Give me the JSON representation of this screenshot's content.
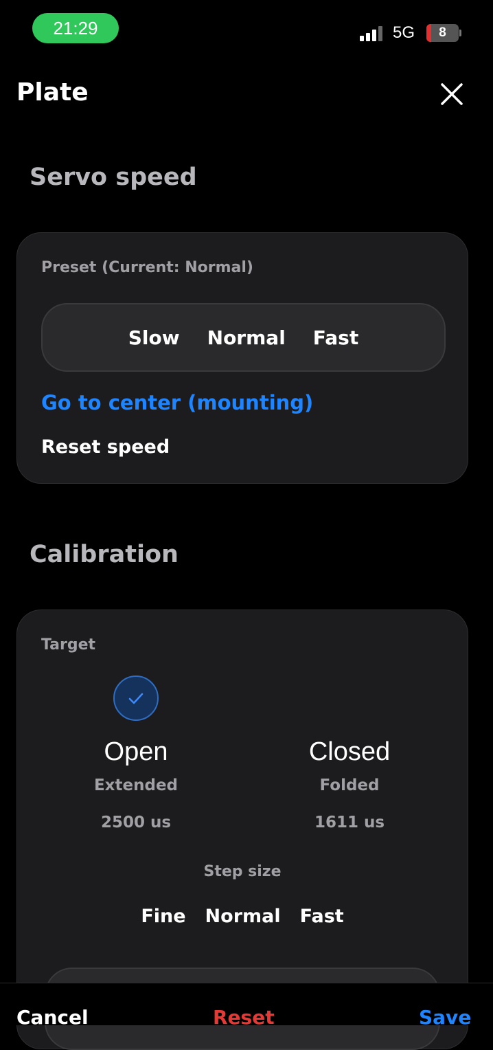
{
  "status": {
    "time": "21:29",
    "network": "5G",
    "battery": "8"
  },
  "header": {
    "title": "Plate"
  },
  "servo": {
    "title": "Servo speed",
    "preset_label": "Preset (Current: Normal)",
    "options": [
      "Slow",
      "Normal",
      "Fast"
    ],
    "center_link": "Go to center (mounting)",
    "reset_link": "Reset speed"
  },
  "calibration": {
    "title": "Calibration",
    "target_label": "Target",
    "open": {
      "name": "Open",
      "sub": "Extended",
      "value": "2500 us"
    },
    "closed": {
      "name": "Closed",
      "sub": "Folded",
      "value": "1611 us"
    },
    "step_label": "Step size",
    "step_options": [
      "Fine",
      "Normal",
      "Fast"
    ]
  },
  "footer": {
    "cancel": "Cancel",
    "reset": "Reset",
    "save": "Save"
  },
  "colors": {
    "accent": "#1e85ff",
    "danger": "#e53935",
    "success": "#30c85a"
  }
}
